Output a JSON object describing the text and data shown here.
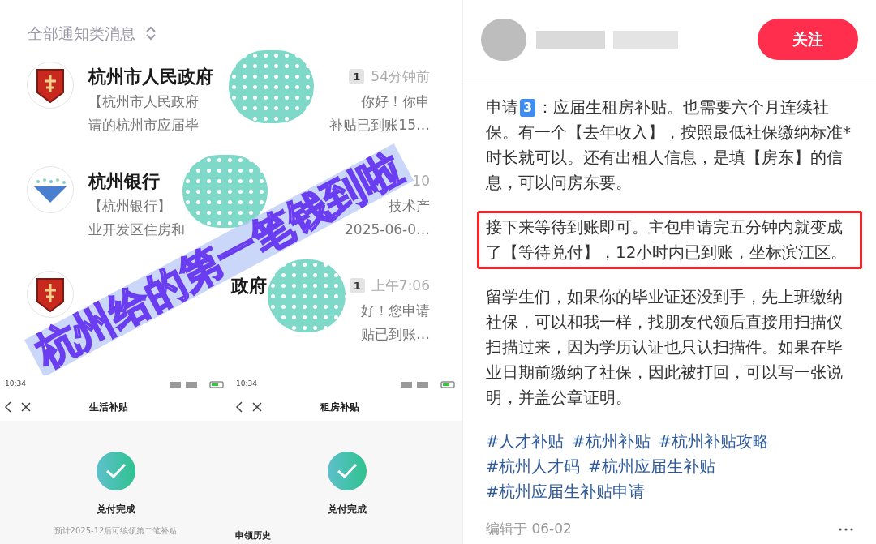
{
  "image": {
    "filter_label": "全部通知类消息",
    "messages": [
      {
        "kind": "gov",
        "title": "杭州市人民政府",
        "badge": "1",
        "time": "54分钟前",
        "lines": [
          [
            "【杭州市人民政府",
            "你好！你申"
          ],
          [
            "请的杭州市应届毕",
            "补贴已到账15…"
          ]
        ]
      },
      {
        "kind": "bank",
        "title": "杭州银行",
        "time": "10",
        "lines": [
          [
            "【杭州银行】",
            "技术产"
          ],
          [
            "业开发区住房和",
            "2025-06-0…"
          ]
        ]
      },
      {
        "kind": "gov",
        "title": "政府",
        "badge": "1",
        "time": "上午7:06",
        "lines": [
          [
            "好！您申请"
          ],
          [
            "贴已到账…"
          ]
        ]
      }
    ],
    "sticker": "杭州给的第一笔钱到啦",
    "phones": [
      {
        "time": "10:34",
        "title": "生活补贴",
        "status": "兑付完成",
        "note": "预计2025-12后可续领第二笔补贴"
      },
      {
        "time": "10:34",
        "title": "租房补贴",
        "status": "兑付完成",
        "section": "申领历史"
      }
    ]
  },
  "post": {
    "follow_button": "关注",
    "paragraphs": [
      {
        "highlighted": false,
        "parts": [
          {
            "kind": "inline",
            "text": "申请"
          },
          {
            "kind": "keycap",
            "text": "3"
          },
          {
            "kind": "inline",
            "text": "：应届生租房补贴。也需要六个月连续社"
          },
          {
            "kind": "block",
            "text": "保。有一个【去年收入】，按照最低社保缴纳标准*时长就可以。还有出租人信息，是填【房东】的信息，可以问房东要。"
          }
        ]
      },
      {
        "highlighted": true,
        "parts": [
          {
            "kind": "block",
            "text": "接下来等待到账即可。主包申请完五分钟内就变成了【等待兑付】，12小时内已到账，坐标滨江区。"
          }
        ]
      },
      {
        "highlighted": false,
        "parts": [
          {
            "kind": "block",
            "text": "留学生们，如果你的毕业证还没到手，先上班缴纳社保，可以和我一样，找朋友代领后直接用扫描仪扫描过来，因为学历认证也只认扫描件。如果在毕业日期前缴纳了社保，因此被打回，可以写一张说明，并盖公章证明。"
          }
        ]
      }
    ],
    "hashtags": [
      "#人才补贴",
      "#杭州补贴",
      "#杭州补贴攻略",
      "#杭州人才码",
      "#杭州应届生补贴",
      "#杭州应届生补贴申请"
    ],
    "edited": "编辑于 06-02"
  }
}
